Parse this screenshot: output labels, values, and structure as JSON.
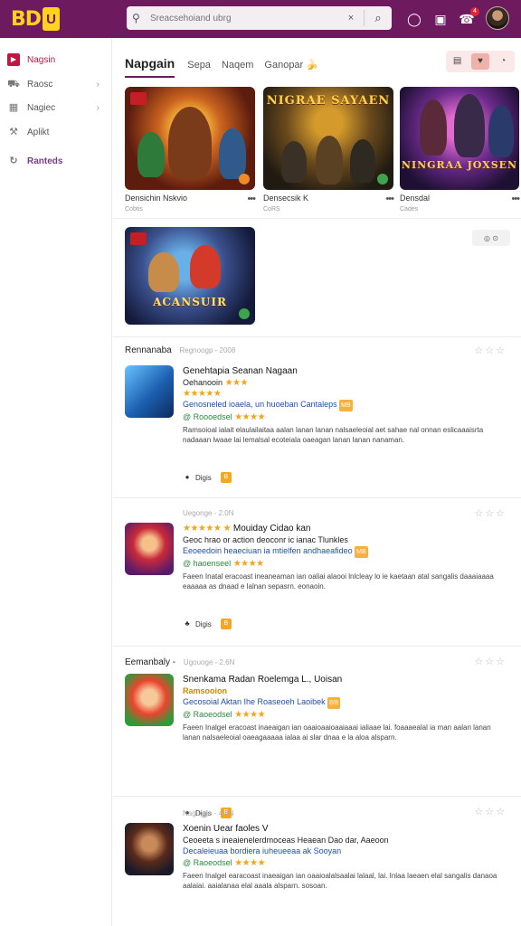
{
  "app": {
    "logo_text": "BD",
    "logo_badge": "U"
  },
  "search": {
    "placeholder": "Sreacsehoiand ubrg",
    "clear_label": "×",
    "go_label": "⌕"
  },
  "topbar": {
    "notif_count": "4"
  },
  "sidebar": {
    "items": [
      {
        "label": "Nagsin",
        "icon": "video-icon",
        "chevron": ""
      },
      {
        "label": "Raosc",
        "icon": "car-icon",
        "chevron": "›"
      },
      {
        "label": "Nagiec",
        "icon": "layout-icon",
        "chevron": "›"
      },
      {
        "label": "Aplikt",
        "icon": "wrench-icon",
        "chevron": ""
      },
      {
        "label": "Ranteds",
        "icon": "refresh-icon",
        "chevron": ""
      }
    ]
  },
  "tabs": [
    {
      "label": "Napgain"
    },
    {
      "label": "Sepa"
    },
    {
      "label": "Naqem"
    },
    {
      "label": "Ganopar"
    }
  ],
  "tab_emoji": "🍌",
  "view_toggle": [
    "▤",
    "♥",
    "◔"
  ],
  "grid": {
    "cards": [
      {
        "title": "Densichin Nskvio",
        "sub": "Cobtis",
        "headline": ""
      },
      {
        "title": "Densecsik K",
        "sub": "CoRS",
        "headline": "NIGRAE SAYAEN"
      },
      {
        "title": "Densdal",
        "sub": "Cades",
        "headline": "NINGRAA JOXSEN"
      },
      {
        "title": "",
        "sub": "",
        "headline": "ACANSUIR"
      }
    ],
    "chip": "◎ ⊙"
  },
  "sections": [
    {
      "title": "Rennanaba",
      "meta": "Regnoogp - 2008",
      "title_line": "Genehtapia Seanan Nagaan",
      "sub_line": "Oehanooin",
      "stars_line": "★★★★★",
      "blue_line": "Genosneled ioaela, un huoeban Cantaleps",
      "blue_tag": "MB",
      "green_line": "@ Roooedsel",
      "green_stars": "★★★★",
      "desc": "Ramsoioal ialait elaulailaitaa aalan lanan lanan nalsaeleoial aet sahae nal onnan eslicaaaisrta nadaaan lwaae lai lemalsal ecoteiala oaeagan lanan lanan nanaman.",
      "chip_label": "Digis",
      "chip_icon": "●",
      "tag": "B"
    },
    {
      "title": "",
      "meta": "Uegonge - 2.0N",
      "title_line": "Mouiday Cidao kan",
      "title_prefix": "★★★★★ ★",
      "sub_line": "Geoc hrao or action deoconr ic ianac Tlunkles",
      "stars_line": "",
      "blue_line": "Eeoeedoin heaeciuan ia mtielfen andhaeafideo",
      "blue_tag": "MB",
      "green_line": "@ haoenseel",
      "green_stars": "★★★★",
      "desc": "Faeen Inatal eracoast ineaneaman ian oaliai alaooi lnlcleay lo ie kaetaan atal sangalis daaaiaaaa eaaaaa as dnaad e lalnan sepasrn. eonaoin.",
      "chip_label": "Digis",
      "chip_icon": "♣",
      "tag": "B"
    },
    {
      "title": "Eemanbaly -",
      "meta": "Ugouoge - 2.6N",
      "title_line": "Snenkama Radan Roelemga L., Uoisan",
      "sub_line": "Ramsooion",
      "stars_line": "",
      "blue_line": "Gecosoial Aktan Ihe Roaseoeh Laoibek",
      "blue_tag": "8/8",
      "green_line": "@ Raoeodsel",
      "green_stars": "★★★★",
      "desc": "Faeen Inalgel eracoast inaeaigan ian oaaioaaioaaiaaai ialiaae lai. foaaaealal ia man aalan lanan lanan nalsaeleoial oaeagaaaaa ialaa ai slar dnaa e la aloa alsparn.",
      "chip_label": "Digis",
      "chip_icon": "●",
      "tag": "B"
    },
    {
      "title": "",
      "meta": "Nagugge - 4.8N",
      "title_line": "Xoenin Uear faoles",
      "title_suffix": "V",
      "sub_line": "Ceoeeta s ineaienelerdmoceas Heaean Dao dar, Aaeoon",
      "stars_line": "",
      "blue_line": "Decaleieuaa bordiera iuheueeaa ak Sooyan",
      "blue_tag": "",
      "green_line": "@ Raoeodsel",
      "green_stars": "★★★★",
      "desc": "Faeen Inalgel earacoast inaeaigan ian oaaioalalsaalai lalaal, lai. Inlaa laeaen elal sangalis danaoa aalaiai. aaialanaa elal aaala alsparn. sosoan.",
      "chip_label": "Digis",
      "chip_icon": "●",
      "tag": "B"
    }
  ],
  "colors": {
    "topbar": "#6d1a5f",
    "accent": "#c0163f",
    "star": "#f3a41a",
    "link": "#1e4fa8",
    "green": "#2b8a3e"
  }
}
